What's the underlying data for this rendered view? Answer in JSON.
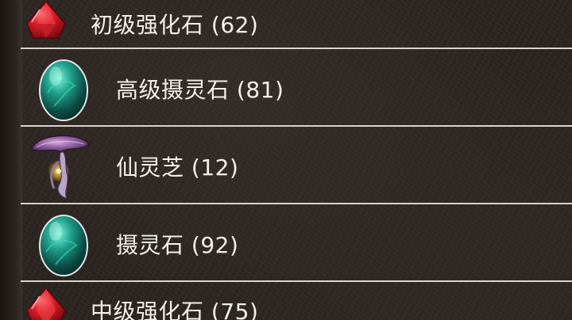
{
  "inventory": {
    "items": [
      {
        "name": "初级强化石",
        "count": "(62)",
        "label": "初级强化石 (62)",
        "icon": "red-gem-icon"
      },
      {
        "name": "高级摄灵石",
        "count": "(81)",
        "label": "高级摄灵石 (81)",
        "icon": "teal-egg-stone-icon"
      },
      {
        "name": "仙灵芝",
        "count": "(12)",
        "label": "仙灵芝 (12)",
        "icon": "purple-mushroom-icon"
      },
      {
        "name": "摄灵石",
        "count": "(92)",
        "label": "摄灵石 (92)",
        "icon": "teal-egg-stone-icon"
      },
      {
        "name": "中级强化石",
        "count": "(75)",
        "label": "中级强化石 (75)",
        "icon": "red-gem-icon"
      }
    ]
  },
  "colors": {
    "background": "#2b2420",
    "divider": "#d8d4cf",
    "text": "#f4f1ec",
    "gem_red": "#d8222a",
    "stone_teal": "#1f9a86",
    "mushroom_purple": "#8a5a9a"
  }
}
